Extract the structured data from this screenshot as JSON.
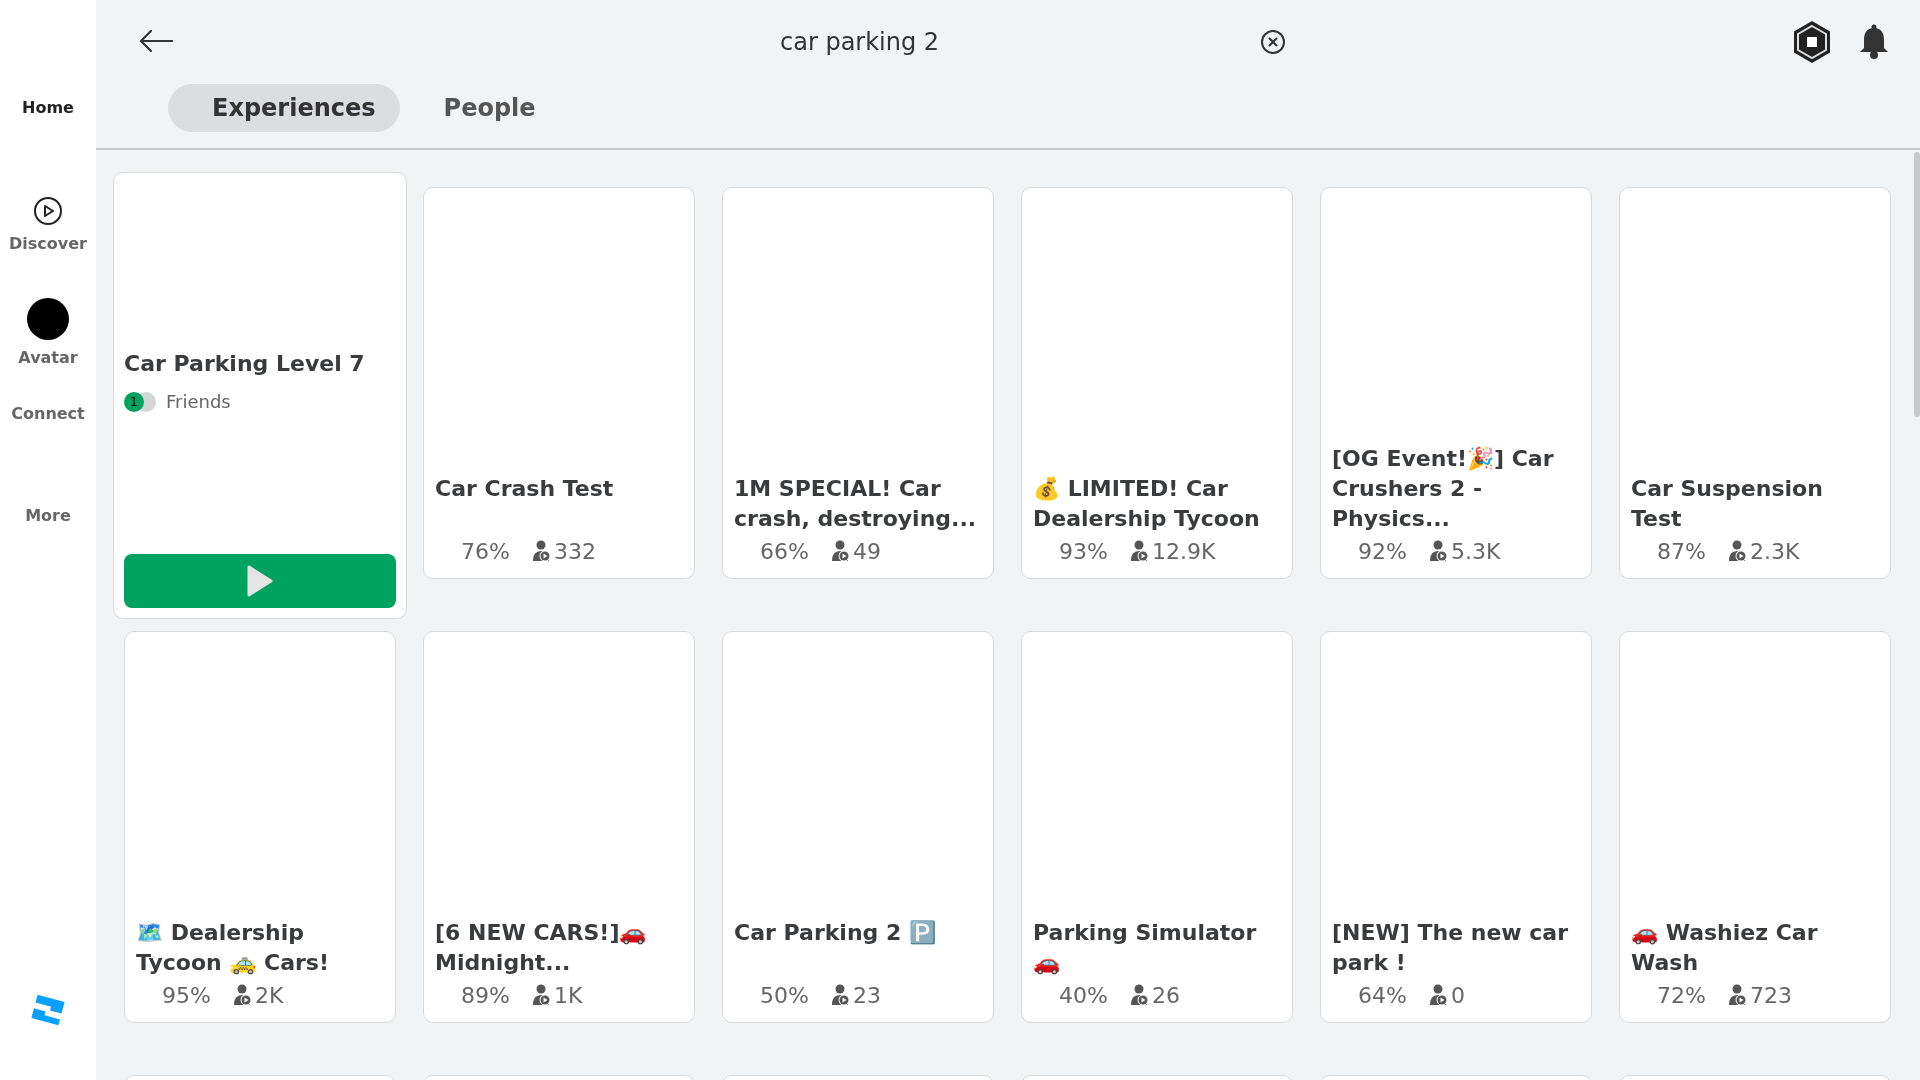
{
  "sidebar": {
    "items": [
      {
        "label": "Home",
        "kind": "text",
        "selected": true
      },
      {
        "label": "Discover",
        "kind": "play",
        "selected": false
      },
      {
        "label": "Avatar",
        "kind": "avatar",
        "selected": false
      },
      {
        "label": "Connect",
        "kind": "text",
        "selected": false
      },
      {
        "label": "More",
        "kind": "text",
        "selected": false
      }
    ]
  },
  "search": {
    "value": "car parking 2"
  },
  "tabs": [
    {
      "label": "Experiences",
      "selected": true
    },
    {
      "label": "People",
      "selected": false
    }
  ],
  "cards": [
    {
      "kind": "featured",
      "title": "Car Parking Level 7",
      "friends_count": "1",
      "friends_label": "Friends"
    },
    {
      "kind": "game",
      "title": "Car Crash Test",
      "rating": "76%",
      "players": "332"
    },
    {
      "kind": "game",
      "title": "1M SPECIAL! Car crash, destroying...",
      "rating": "66%",
      "players": "49"
    },
    {
      "kind": "game",
      "title": "💰 LIMITED! Car Dealership Tycoon",
      "rating": "93%",
      "players": "12.9K"
    },
    {
      "kind": "game",
      "title": "[OG Event!🎉] Car Crushers 2 - Physics...",
      "rating": "92%",
      "players": "5.3K"
    },
    {
      "kind": "game",
      "title": "Car Suspension Test",
      "rating": "87%",
      "players": "2.3K"
    },
    {
      "kind": "game",
      "title": "🗺️ Dealership Tycoon 🚕 Cars!",
      "rating": "95%",
      "players": "2K"
    },
    {
      "kind": "game",
      "title": "[6 NEW CARS!]🚗Midnight...",
      "rating": "89%",
      "players": "1K"
    },
    {
      "kind": "game",
      "title": "Car Parking 2 🅿️",
      "rating": "50%",
      "players": "23"
    },
    {
      "kind": "game",
      "title": "Parking Simulator 🚗",
      "rating": "40%",
      "players": "26"
    },
    {
      "kind": "game",
      "title": "[NEW] The new car park !",
      "rating": "64%",
      "players": "0"
    },
    {
      "kind": "game",
      "title": "🚗 Washiez Car Wash",
      "rating": "72%",
      "players": "723"
    },
    {
      "kind": "empty"
    },
    {
      "kind": "empty"
    },
    {
      "kind": "empty"
    },
    {
      "kind": "empty"
    },
    {
      "kind": "empty"
    },
    {
      "kind": "empty"
    }
  ]
}
